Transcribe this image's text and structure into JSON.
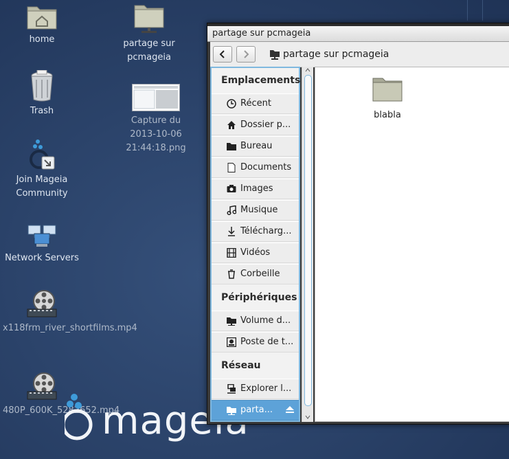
{
  "desktop": {
    "icons": [
      {
        "label": "home",
        "icon": "home-folder-icon"
      },
      {
        "label": "partage sur pcmageia",
        "icon": "network-folder-icon"
      },
      {
        "label": "Trash",
        "icon": "trash-icon"
      },
      {
        "label": "Capture du 2013-10-06 21:44:18.png",
        "icon": "screenshot-thumbnail-icon"
      },
      {
        "label": "Join Mageia Community",
        "icon": "mageia-link-icon"
      },
      {
        "label": "Network Servers",
        "icon": "network-servers-icon"
      },
      {
        "label": "x118frm_river_shortfilms.mp4",
        "icon": "film-reel-icon"
      },
      {
        "label": "480P_600K_5282652.mp4",
        "icon": "film-reel-icon"
      }
    ],
    "wallpaper_brand": "mageia",
    "colors": {
      "wallpaper": "#2b436a",
      "text": "#dfe6f0"
    }
  },
  "window": {
    "title": "partage sur pcmageia",
    "location": "partage sur pcmageia",
    "back_icon": "chevron-left-icon",
    "forward_icon": "chevron-right-icon"
  },
  "sidebar": {
    "sections": [
      {
        "heading": "Emplacements",
        "items": [
          {
            "label": "Récent",
            "icon": "clock-icon"
          },
          {
            "label": "Dossier p...",
            "icon": "home-icon"
          },
          {
            "label": "Bureau",
            "icon": "desktop-folder-icon"
          },
          {
            "label": "Documents",
            "icon": "document-icon"
          },
          {
            "label": "Images",
            "icon": "camera-icon"
          },
          {
            "label": "Musique",
            "icon": "music-icon"
          },
          {
            "label": "Télécharg...",
            "icon": "download-icon"
          },
          {
            "label": "Vidéos",
            "icon": "film-icon"
          },
          {
            "label": "Corbeille",
            "icon": "trash-icon"
          }
        ]
      },
      {
        "heading": "Périphériques",
        "items": [
          {
            "label": "Volume d...",
            "icon": "drive-icon"
          },
          {
            "label": "Poste de t...",
            "icon": "computer-icon"
          }
        ]
      },
      {
        "heading": "Réseau",
        "items": [
          {
            "label": "Explorer l...",
            "icon": "network-icon"
          },
          {
            "label": "parta...",
            "icon": "network-share-icon",
            "selected": true
          }
        ]
      }
    ],
    "colors": {
      "selected": "#5da2d8",
      "focus_border": "#7fb8df"
    }
  },
  "content": {
    "files": [
      {
        "label": "blabla",
        "icon": "folder-icon"
      }
    ]
  }
}
